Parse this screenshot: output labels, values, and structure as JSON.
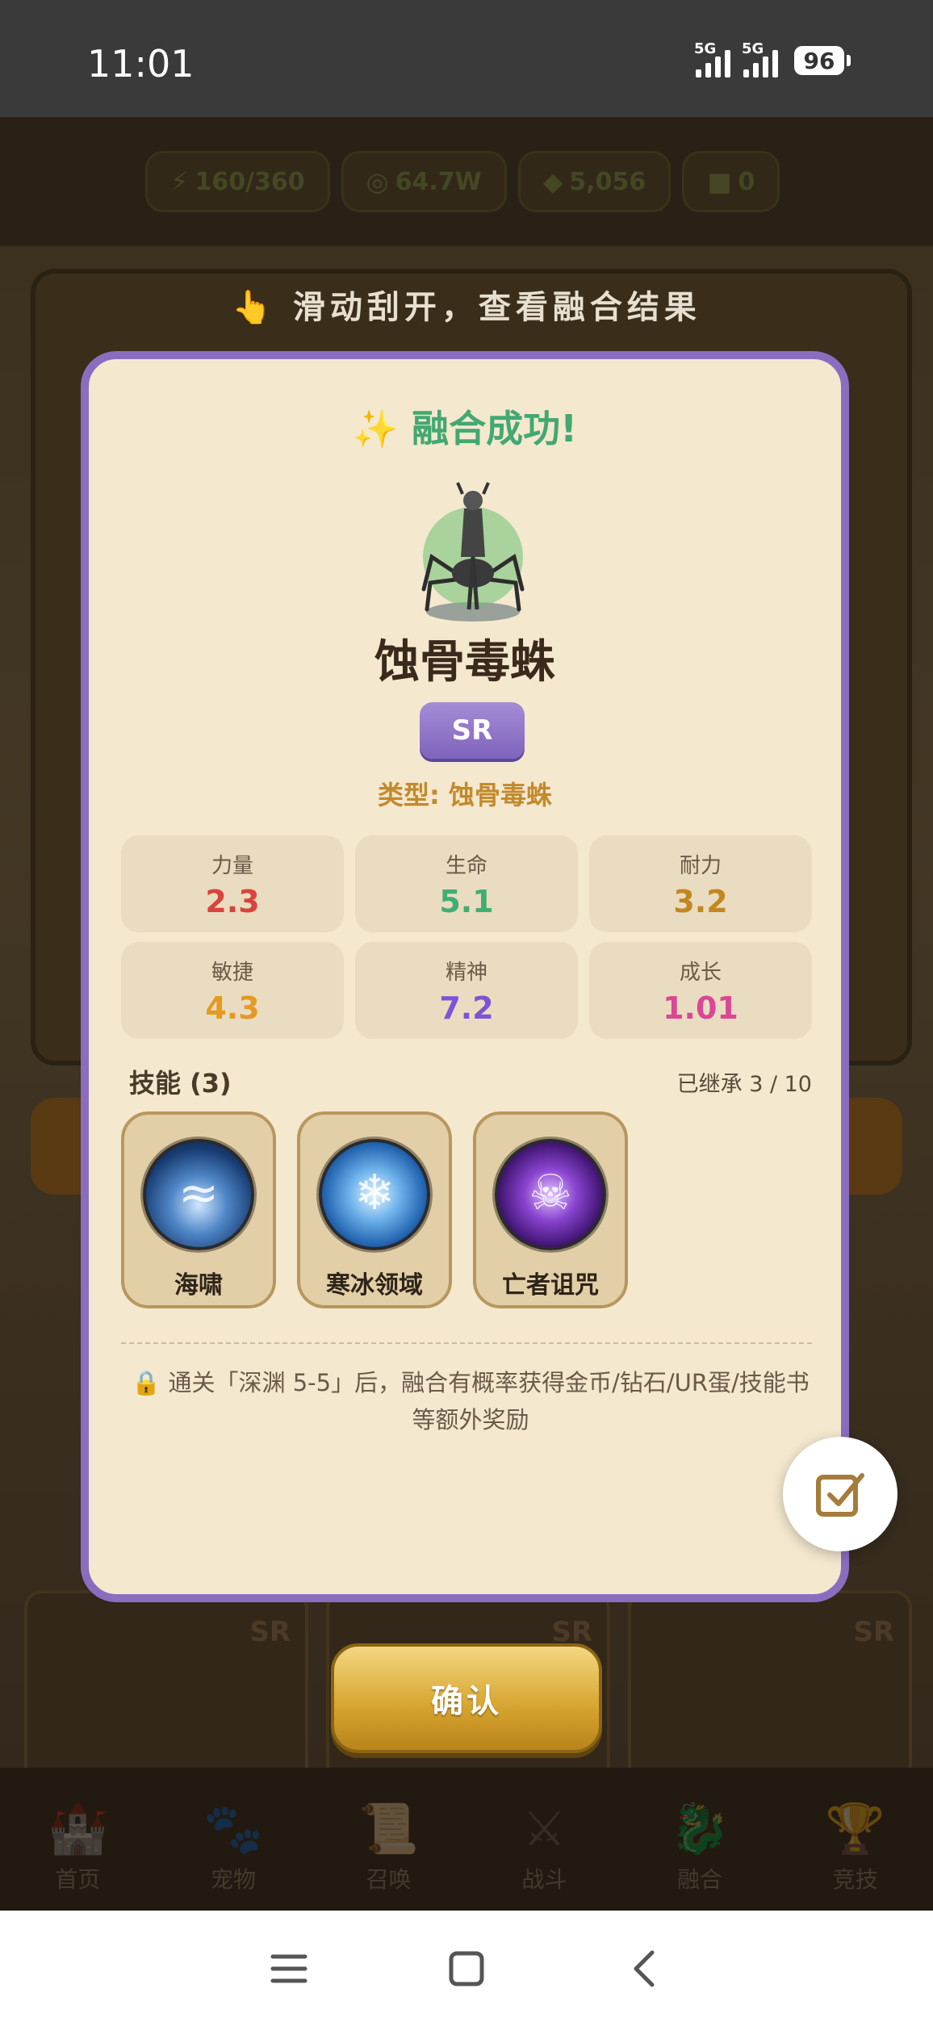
{
  "status_bar": {
    "time": "11:01",
    "signal_1_label": "5G",
    "signal_2_label": "5G",
    "battery": "96"
  },
  "currencies": [
    {
      "icon": "lightning-icon",
      "glyph": "⚡",
      "value": "160/360"
    },
    {
      "icon": "coin-icon",
      "glyph": "◎",
      "value": "64.7W"
    },
    {
      "icon": "gem-icon",
      "glyph": "◆",
      "value": "5,056"
    },
    {
      "icon": "egg-icon",
      "glyph": "■",
      "value": "0"
    }
  ],
  "hint": "👆 滑动刮开，查看融合结果",
  "modal": {
    "title_spark": "✨",
    "title": "融合成功!",
    "pet_name": "蚀骨毒蛛",
    "rarity": "SR",
    "type_label": "类型: 蚀骨毒蛛",
    "stats": [
      {
        "label": "力量",
        "value": "2.3",
        "color": "#d9433c"
      },
      {
        "label": "生命",
        "value": "5.1",
        "color": "#3fae72"
      },
      {
        "label": "耐力",
        "value": "3.2",
        "color": "#c2871f"
      },
      {
        "label": "敏捷",
        "value": "4.3",
        "color": "#e49a24"
      },
      {
        "label": "精神",
        "value": "7.2",
        "color": "#7b55d6"
      },
      {
        "label": "成长",
        "value": "1.01",
        "color": "#d94796"
      }
    ],
    "skills_title": "技能 (3)",
    "inherit": "已继承 3 / 10",
    "skills": [
      {
        "name": "海啸",
        "icon": "tsunami-icon"
      },
      {
        "name": "寒冰领域",
        "icon": "ice-field-icon"
      },
      {
        "name": "亡者诅咒",
        "icon": "death-curse-icon"
      }
    ],
    "note": "🔒 通关「深渊 5-5」后，融合有概率获得金币/钻石/UR蛋/技能书等额外奖励"
  },
  "confirm_label": "确认",
  "background_cards": [
    "SR",
    "SR",
    "SR"
  ],
  "nav": [
    {
      "label": "首页",
      "glyph": "🏰"
    },
    {
      "label": "宠物",
      "glyph": "🐾"
    },
    {
      "label": "召唤",
      "glyph": "📜"
    },
    {
      "label": "战斗",
      "glyph": "⚔"
    },
    {
      "label": "融合",
      "glyph": "🐉"
    },
    {
      "label": "竞技",
      "glyph": "🏆"
    }
  ]
}
